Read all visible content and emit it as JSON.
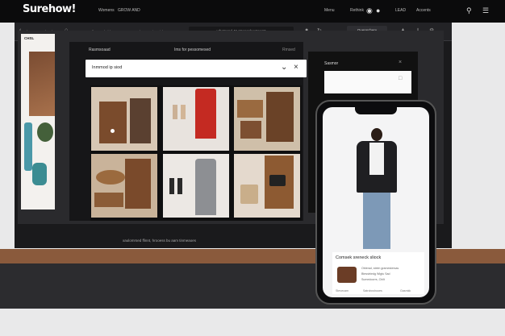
{
  "header": {
    "logo": "Surehow!",
    "nav": [
      "Womens",
      "GROW AND",
      "Menu",
      "Rethink",
      "LEAD",
      "Accents"
    ]
  },
  "toolbar": {
    "items": [
      "tbs",
      "Wheeler",
      "Hanodler Redtoble",
      "Hodcotte",
      "tieFoicks"
    ],
    "address": "whetsand 46 strosonleesteemt",
    "right_button": "Quenschery"
  },
  "left_panel": {
    "header": "CHSL"
  },
  "main": {
    "titles": [
      "Rasmsoaad",
      "Ims for pessomesed",
      "Rmsed"
    ],
    "select_text": "Inmmod ip siod",
    "footer": "xaulomrsed ffinnt, hrooess bu aam tinmeaoes"
  },
  "side_card": {
    "title": "Sasmor"
  },
  "phone": {
    "card_title": "Comsek sreneck sliock",
    "lines": [
      "Oblerad, stelm gramestersas",
      "Btesstriedg Wigtu Sad",
      "Sumedoorrs, Chilt"
    ],
    "footer": [
      "Stevecam",
      "Satrcbcshooes",
      "Gasmkk"
    ]
  },
  "colors": {
    "topbar": "#0b0b0c",
    "panel": "#161618",
    "shelf": "#8a5a3c",
    "background": "#e9e9ea"
  }
}
